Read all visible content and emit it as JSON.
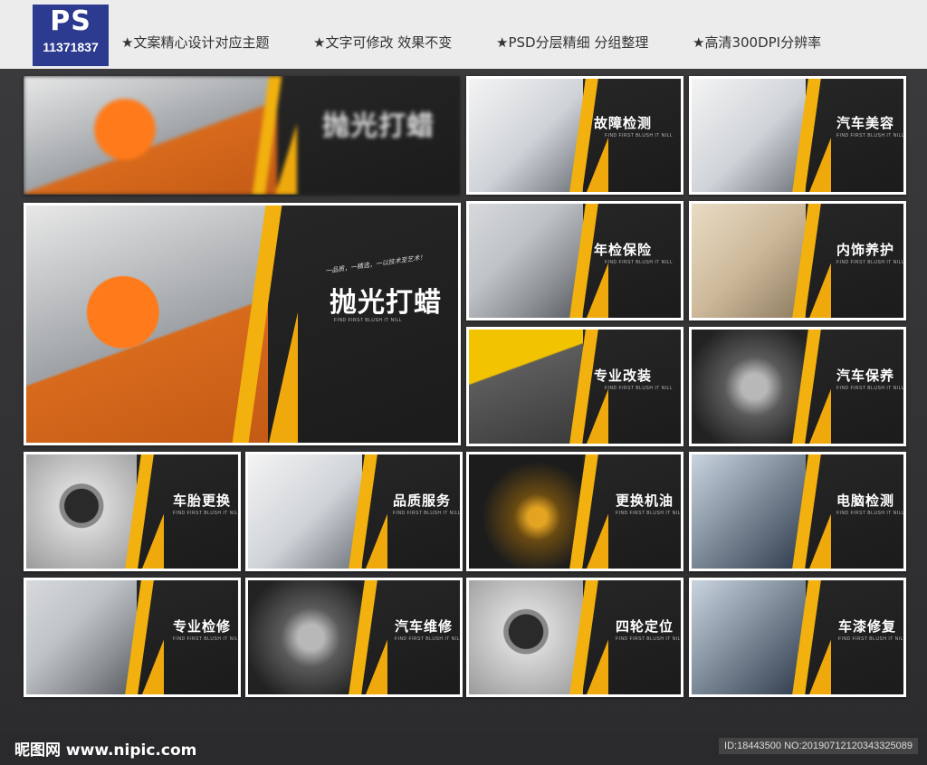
{
  "header": {
    "logo_ps": "PS",
    "logo_id": "11371837",
    "features": [
      "★文案精心设计对应主题",
      "★文字可修改 效果不变",
      "★PSD分层精细 分组整理",
      "★高清300DPI分辨率"
    ]
  },
  "hero": {
    "title": "抛光打蜡",
    "script": "一品质，一精选，一以技术至艺术！",
    "sub": "FIND FIRST BLUSH IT NILL"
  },
  "banner_title": "抛光打蜡",
  "cards": [
    {
      "title": "故障检测"
    },
    {
      "title": "汽车美容"
    },
    {
      "title": "年检保险"
    },
    {
      "title": "内饰养护"
    },
    {
      "title": "专业改装"
    },
    {
      "title": "汽车保养"
    },
    {
      "title": "车胎更换"
    },
    {
      "title": "品质服务"
    },
    {
      "title": "更换机油"
    },
    {
      "title": "电脑检测"
    },
    {
      "title": "专业检修"
    },
    {
      "title": "汽车维修"
    },
    {
      "title": "四轮定位"
    },
    {
      "title": "车漆修复"
    }
  ],
  "card_sub": "FIND FIRST BLUSH IT NILL",
  "footer": {
    "site": "昵图网 www.nipic.com",
    "id_code": "ID:18443500 NO:20190712120343325089"
  },
  "colors": {
    "accent": "#f2b10e",
    "brand_blue": "#2c3a8f",
    "panel": "#1f1f1f"
  }
}
